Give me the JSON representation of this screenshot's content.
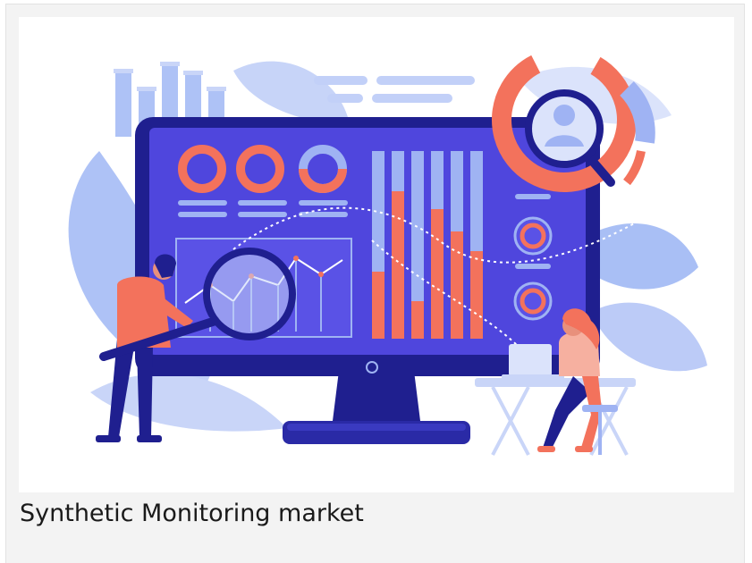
{
  "card": {
    "caption": "Synthetic Monitoring market"
  },
  "illustration": {
    "icon": "analytics-dashboard-illustration",
    "colors": {
      "navy": "#1f1f8f",
      "screen": "#4f46dd",
      "screen_dark": "#3a34c0",
      "coral": "#f3725c",
      "periwinkle": "#9fb3f3",
      "lavender": "#c9d3f7",
      "leaf": "#a9bff5",
      "white": "#ffffff"
    }
  }
}
